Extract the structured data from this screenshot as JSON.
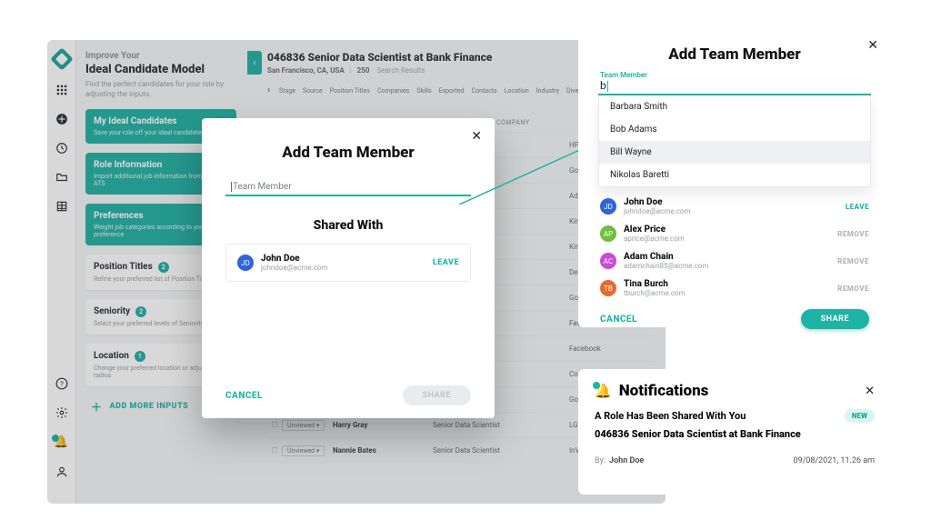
{
  "app": {
    "eyebrow": "Improve Your",
    "heading": "Ideal Candidate Model",
    "blurb": "Find the perfect candidates for your role by adjusting the inputs.",
    "cards": [
      {
        "title": "My Ideal Candidates",
        "sub": "Save your role off your ideal candidate"
      },
      {
        "title": "Role Information",
        "sub": "Import additional job information from your ATS"
      },
      {
        "title": "Preferences",
        "sub": "Weight job categories according to your preference"
      }
    ],
    "prefs": [
      {
        "title": "Position Titles",
        "badge": "2",
        "sub": "Refine your preferred list of Position Titles"
      },
      {
        "title": "Seniority",
        "badge": "2",
        "sub": "Select your preferred levels of Seniority"
      },
      {
        "title": "Location",
        "badge": "1",
        "sub": "Change your preferred location or adjust the radius"
      }
    ],
    "add_more": "ADD MORE INPUTS"
  },
  "role": {
    "title": "046836 Senior Data Scientist at Bank Finance",
    "location": "San Francisco, CA, USA",
    "count": "250",
    "count_label": "Search Results",
    "filters": [
      "Stage",
      "Source",
      "Position Titles",
      "Companies",
      "Skills",
      "Exported",
      "Contacts",
      "Location",
      "Industry",
      "Diversity"
    ],
    "company_header": "COMPANY",
    "rows": [
      {
        "name": "",
        "title": "",
        "company": "HP"
      },
      {
        "name": "",
        "title": "",
        "company": "Google"
      },
      {
        "name": "",
        "title": "",
        "company": "Adobe"
      },
      {
        "name": "",
        "title": "",
        "company": "Kingstone"
      },
      {
        "name": "",
        "title": "",
        "company": "Kingstone"
      },
      {
        "name": "",
        "title": "",
        "company": "Dell"
      },
      {
        "name": "",
        "title": "",
        "company": "Google"
      },
      {
        "name": "",
        "title": "",
        "company": "Facebook"
      },
      {
        "name": "",
        "title": "",
        "company": "Facebook"
      },
      {
        "name": "",
        "title": "",
        "company": "Company"
      },
      {
        "name": "",
        "title": "",
        "company": "Google"
      },
      {
        "name": "Harry Gray",
        "title": "Senior Data Scientist",
        "company": "LG Electronics"
      },
      {
        "name": "Nannie Bates",
        "title": "Senior Data Scientist",
        "company": "InVision"
      }
    ],
    "tag_label": "Unviewed"
  },
  "modal1": {
    "title": "Add Team Member",
    "placeholder": "Team Member",
    "shared_heading": "Shared With",
    "member": {
      "name": "John Doe",
      "email": "johndoe@acme.com",
      "avatar_color": "#2f64d8",
      "initials": "JD"
    },
    "leave": "LEAVE",
    "cancel": "CANCEL",
    "share": "SHARE"
  },
  "modal2": {
    "title": "Add Team Member",
    "float_label": "Team Member",
    "query": "b",
    "options": [
      "Barbara Smith",
      "Bob Adams",
      "Bill Wayne",
      "Nikolas Baretti"
    ],
    "selected_index": 2,
    "shared": [
      {
        "name": "John Doe",
        "email": "johndoe@acme.com",
        "action": "LEAVE",
        "avatar_color": "#2f64d8",
        "initials": "JD"
      },
      {
        "name": "Alex Price",
        "email": "aprice@acme.com",
        "action": "REMOVE",
        "avatar_color": "#6fbf3b",
        "initials": "AP"
      },
      {
        "name": "Adam Chain",
        "email": "adamchain85@acme.com",
        "action": "REMOVE",
        "avatar_color": "#c84bd6",
        "initials": "AC"
      },
      {
        "name": "Tina Burch",
        "email": "tburch@acme.com",
        "action": "REMOVE",
        "avatar_color": "#e86a2e",
        "initials": "TB"
      }
    ],
    "cancel": "CANCEL",
    "share": "SHARE"
  },
  "notif": {
    "title": "Notifications",
    "line1": "A Role Has Been Shared With You",
    "new_badge": "NEW",
    "line2": "046836 Senior Data Scientist at Bank Finance",
    "by_label": "By:",
    "by_name": "John Doe",
    "timestamp": "09/08/2021, 11.26 am"
  }
}
